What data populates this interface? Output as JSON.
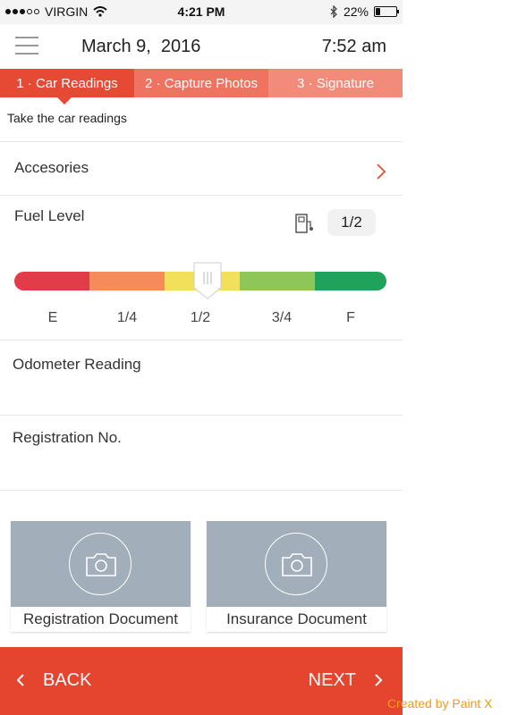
{
  "status_bar": {
    "carrier": "VIRGIN",
    "time": "4:21 PM",
    "battery": "22%",
    "battery_level": 0.22
  },
  "header": {
    "date": "March 9,  2016",
    "time": "7:52 am"
  },
  "steps": [
    {
      "label": "1 · Car Readings",
      "active": true
    },
    {
      "label": "2 · Capture Photos",
      "active": false
    },
    {
      "label": "3 · Signature",
      "active": false
    }
  ],
  "subtitle": "Take the car readings",
  "accessories": {
    "label": "Accesories"
  },
  "fuel": {
    "label": "Fuel Level",
    "value": "1/2",
    "level": 0.5,
    "ticks": [
      "E",
      "1/4",
      "1/2",
      "3/4",
      "F"
    ],
    "colors": [
      "#e23c4a",
      "#f58a5a",
      "#f2e05a",
      "#8fc65a",
      "#1fa35a"
    ]
  },
  "odometer": {
    "label": "Odometer Reading"
  },
  "registration": {
    "label": "Registration No."
  },
  "documents": [
    {
      "label": "Registration Document"
    },
    {
      "label": "Insurance Document"
    }
  ],
  "footer": {
    "back": "BACK",
    "next": "NEXT"
  },
  "watermark": "Created by Paint X",
  "icons": {
    "menu": "hamburger-icon",
    "chevron": "chevron-right-icon",
    "fuel": "fuel-pump-icon",
    "camera": "camera-icon"
  }
}
